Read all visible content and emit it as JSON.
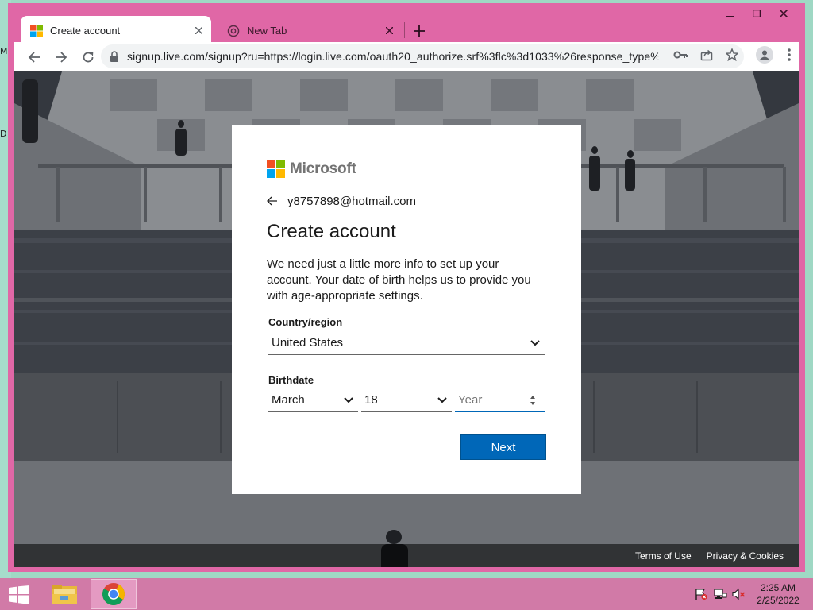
{
  "desktop": {
    "icon_fragments": [
      "M",
      "D"
    ]
  },
  "browser": {
    "tabs": [
      {
        "title": "Create account",
        "favicon": "microsoft-logo-icon",
        "active": true
      },
      {
        "title": "New Tab",
        "favicon": "chrome-newtab-icon",
        "active": false
      }
    ],
    "url": "signup.live.com/signup?ru=https://login.live.com/oauth20_authorize.srf%3flc%3d1033%26response_type%...",
    "window_controls": [
      "minimize-icon",
      "maximize-icon",
      "close-icon"
    ]
  },
  "page": {
    "brand": "Microsoft",
    "brand_colors": [
      "#f25022",
      "#7fba00",
      "#00a4ef",
      "#ffb900"
    ],
    "identity_email": "y8757898@hotmail.com",
    "heading": "Create account",
    "description": "We need just a little more info to set up your account. Your date of birth helps us to provide you with age-appropriate settings.",
    "country_label": "Country/region",
    "country_value": "United States",
    "birthdate_label": "Birthdate",
    "birth_month": "March",
    "birth_day": "18",
    "birth_year_placeholder": "Year",
    "next_button": "Next",
    "accent_color": "#0067b8",
    "footer_links": [
      "Terms of Use",
      "Privacy & Cookies"
    ]
  },
  "taskbar": {
    "time": "2:25 AM",
    "date": "2/25/2022",
    "apps": [
      "file-explorer-icon",
      "chrome-icon"
    ],
    "tray_icons": [
      "action-center-flag-icon",
      "network-icon",
      "volume-muted-icon"
    ]
  }
}
